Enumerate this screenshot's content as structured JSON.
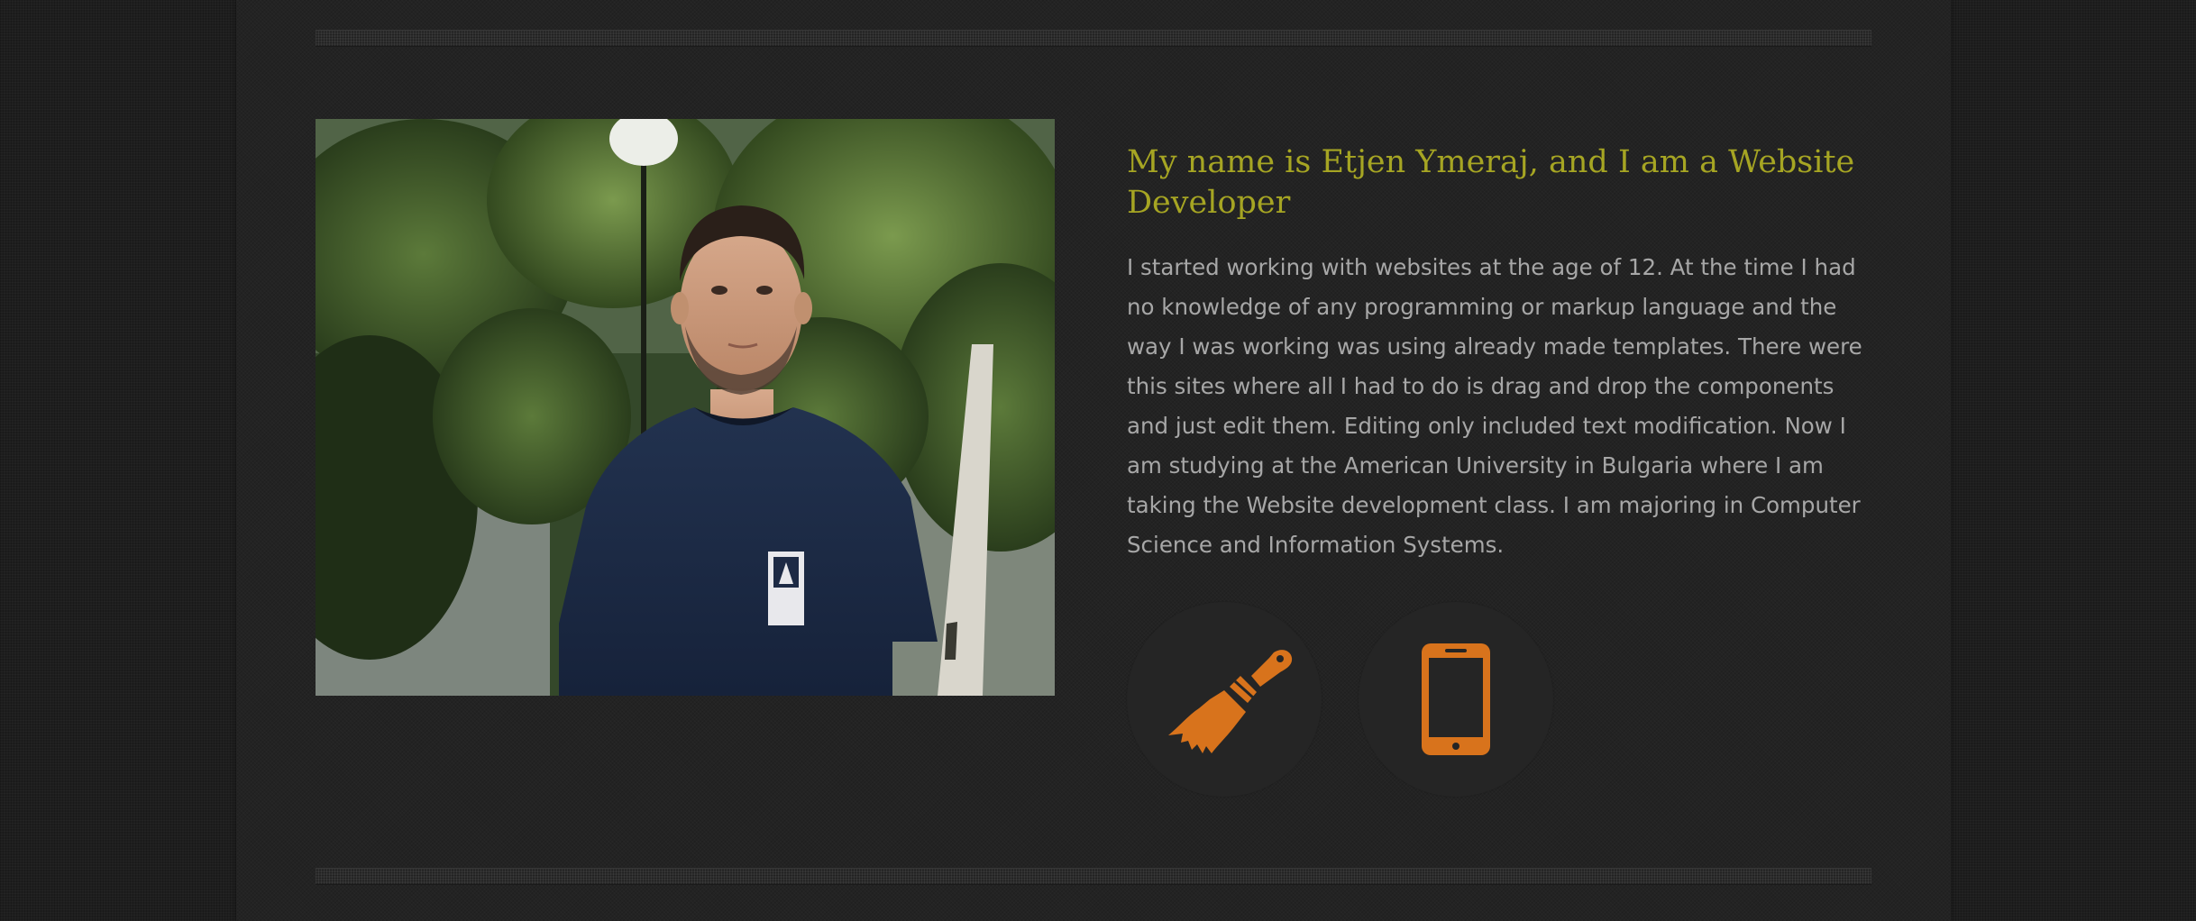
{
  "about": {
    "title": "My name is Etjen Ymeraj, and I am a Website Developer",
    "paragraph": "I started working with websites at the age of 12. At the time I had no knowledge of any programming or markup language and the way I was working was using already made templates. There were this sites where all I had to do is drag and drop the components and just edit them. Editing only included text modification. Now I am studying at the American University in Bulgaria where I am taking the Website development class. I am majoring in Computer Science and Information Systems."
  },
  "skills": [
    {
      "icon": "paintbrush-icon"
    },
    {
      "icon": "smartphone-icon"
    }
  ],
  "colors": {
    "title": "#a6a523",
    "body_text": "#a7a7a7",
    "icon_accent": "#d8731c",
    "circle_bg": "#252525",
    "page_bg": "#1e1e1e"
  }
}
